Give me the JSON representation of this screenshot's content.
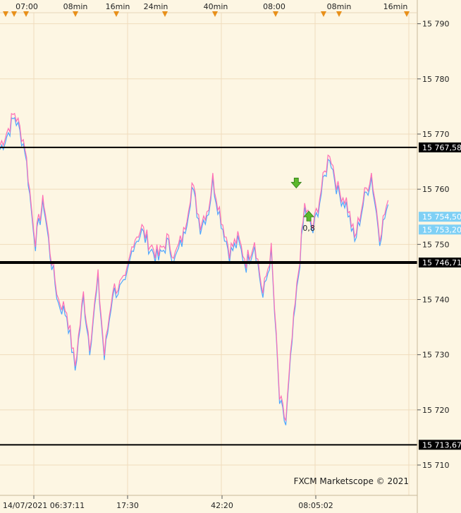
{
  "watermark": "FXCM Marketscope © 2021",
  "colors": {
    "background": "#fdf6e3",
    "grid": "#f0dcbc",
    "bid": "#ff6fb5",
    "ask": "#4da6ff",
    "level_line": "#000000",
    "marker": "#e8901a",
    "arrow": "#5cb82c",
    "price_label_bg": "#7fd0f5",
    "level_label_bg": "#000000"
  },
  "chart_data": {
    "type": "line",
    "title": "",
    "xlabel": "",
    "ylabel": "",
    "ylim": [
      15704.5,
      15792
    ],
    "y_ticks": [
      15790,
      15780,
      15770,
      15760,
      15750,
      15740,
      15730,
      15720,
      15710
    ],
    "y_tick_labels": [
      "15 790",
      "15 780",
      "15 770",
      "15 760",
      "15 750",
      "15 740",
      "15 730",
      "15 720",
      "15 710"
    ],
    "top_time_labels": [
      "07:00",
      "08min",
      "16min",
      "24min",
      "40min",
      "08:00",
      "08min",
      "16min"
    ],
    "bottom_time_labels": [
      "14/07/2021 06:37:11",
      "17:30",
      "42:20",
      "08:05:02"
    ],
    "horizontal_levels": [
      {
        "value": 15767.58,
        "label": "15 767,58"
      },
      {
        "value": 15746.71,
        "label": "15 746,71"
      },
      {
        "value": 15713.67,
        "label": "15 713,67"
      }
    ],
    "current_prices": [
      {
        "value": 15754.5,
        "label": "15 754,50"
      },
      {
        "value": 15753.2,
        "label": "15 753,20"
      }
    ],
    "annotations": [
      {
        "type": "sell-arrow",
        "x": 0.71,
        "y": 15761
      },
      {
        "type": "buy-arrow",
        "x": 0.74,
        "y": 15755,
        "label": "0,8"
      }
    ],
    "series": [
      {
        "x": [
          0,
          0.02,
          0.035,
          0.06,
          0.075,
          0.085,
          0.1,
          0.105,
          0.12,
          0.14,
          0.16,
          0.18,
          0.2,
          0.215,
          0.235,
          0.25,
          0.27,
          0.3,
          0.32,
          0.34,
          0.36,
          0.38,
          0.4,
          0.42,
          0.44,
          0.46,
          0.48,
          0.5,
          0.51,
          0.53,
          0.55,
          0.57,
          0.59,
          0.61,
          0.63,
          0.65,
          0.67,
          0.685,
          0.7,
          0.715,
          0.73,
          0.75,
          0.77,
          0.79,
          0.81,
          0.83,
          0.85,
          0.87,
          0.89,
          0.91,
          0.93
        ],
        "values": [
          15768,
          15771,
          15774,
          15768,
          15757,
          15751,
          15757,
          15758,
          15749,
          15740,
          15738,
          15728,
          15741,
          15732,
          15744,
          15730,
          15742,
          15743,
          15751,
          15753,
          15750,
          15748,
          15751,
          15748,
          15752,
          15761,
          15754,
          15757,
          15762,
          15755,
          15749,
          15751,
          15747,
          15751,
          15741,
          15749,
          15722,
          15718,
          15733,
          15745,
          15757,
          15753,
          15760,
          15767,
          15760,
          15758,
          15751,
          15758,
          15763,
          15752,
          15758
        ]
      }
    ]
  }
}
